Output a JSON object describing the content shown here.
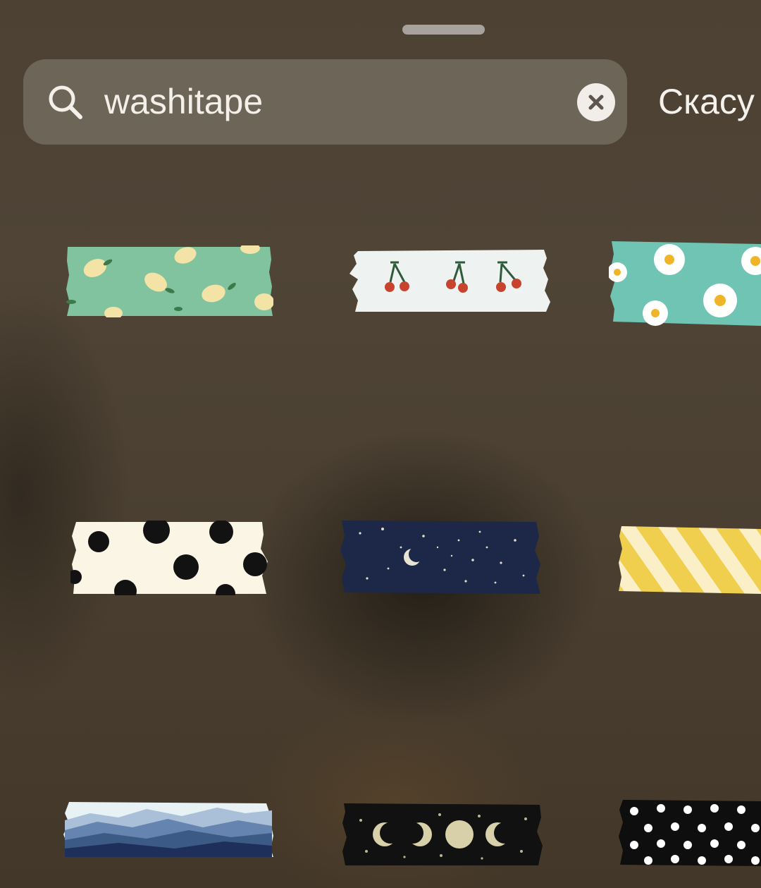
{
  "search": {
    "value": "washitape",
    "placeholder": ""
  },
  "actions": {
    "cancel_label": "Скасу"
  },
  "icons": {
    "search": "search-icon",
    "clear": "close-icon",
    "grabber": "drag-handle"
  },
  "stickers": [
    {
      "name": "lemon-pattern",
      "color": "#82c39f"
    },
    {
      "name": "cherry-pattern",
      "color": "#eef2f0"
    },
    {
      "name": "daisy-pattern",
      "color": "#6fc4b4"
    },
    {
      "name": "polka-dot-cream",
      "color": "#fbf5e6"
    },
    {
      "name": "night-sky-moon",
      "color": "#1d2748"
    },
    {
      "name": "yellow-stripes",
      "color": "#f1cf4e"
    },
    {
      "name": "blue-mountains",
      "color": "#3c5a86"
    },
    {
      "name": "moon-phases",
      "color": "#111111"
    },
    {
      "name": "polka-dot-black",
      "color": "#0e0e0e"
    }
  ]
}
